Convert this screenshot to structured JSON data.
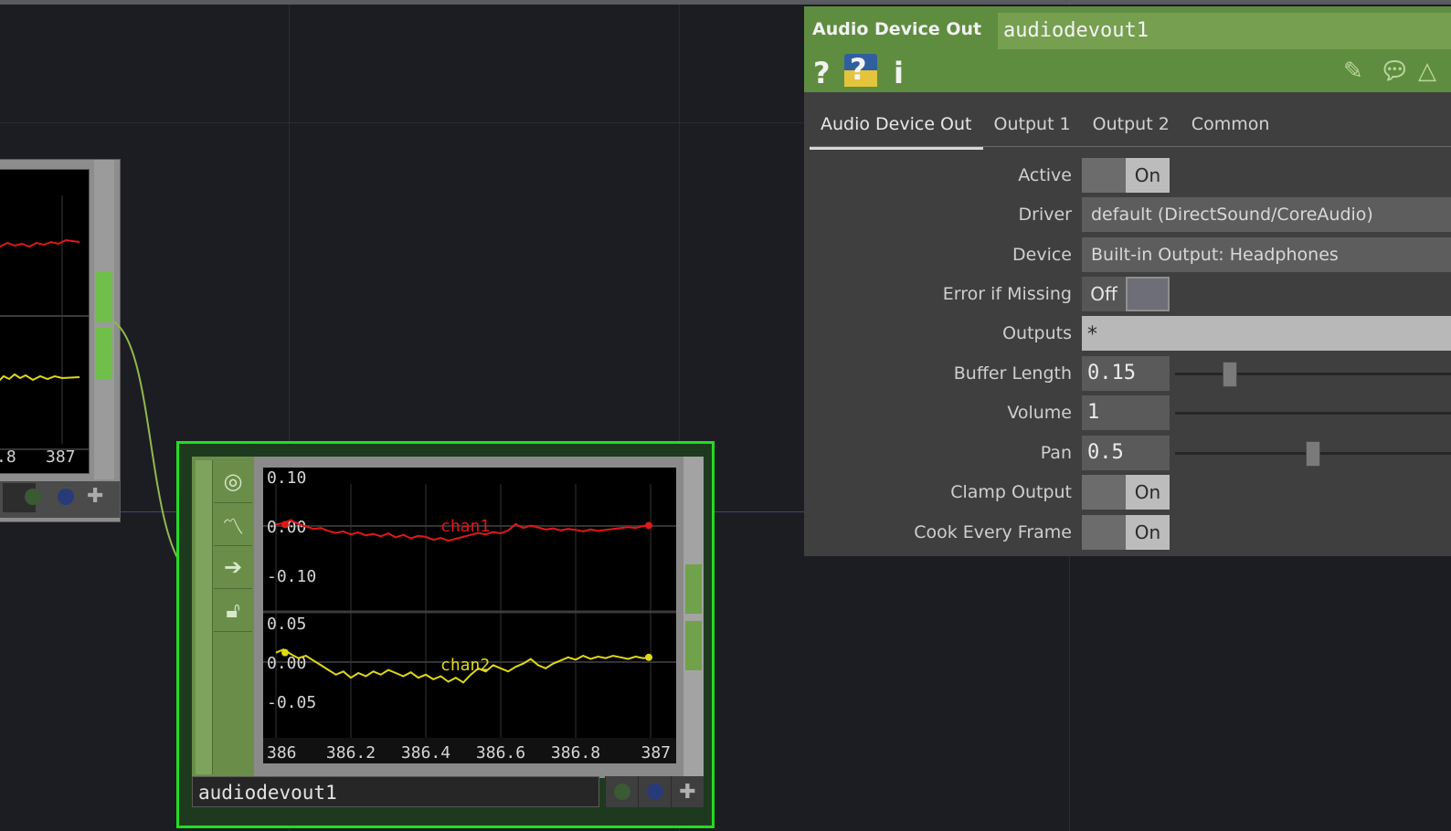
{
  "panel": {
    "op_type": "Audio Device Out",
    "op_name": "audiodevout1",
    "header_icons": [
      "help-icon",
      "python-help-icon",
      "info-icon",
      "pencil-icon",
      "comment-icon",
      "warning-icon"
    ],
    "tabs": [
      {
        "label": "Audio Device Out",
        "active": true
      },
      {
        "label": "Output 1",
        "active": false
      },
      {
        "label": "Output 2",
        "active": false
      },
      {
        "label": "Common",
        "active": false
      }
    ],
    "params": {
      "active": {
        "label": "Active",
        "value": "On"
      },
      "driver": {
        "label": "Driver",
        "value": "default (DirectSound/CoreAudio)"
      },
      "device": {
        "label": "Device",
        "value": "Built-in Output: Headphones"
      },
      "error_if_missing": {
        "label": "Error if Missing",
        "value": "Off"
      },
      "outputs": {
        "label": "Outputs",
        "value": "*"
      },
      "buffer_length": {
        "label": "Buffer Length",
        "value": "0.15",
        "slider_fraction": 0.2
      },
      "volume": {
        "label": "Volume",
        "value": "1",
        "slider_fraction": 0
      },
      "pan": {
        "label": "Pan",
        "value": "0.5",
        "slider_fraction": 0.5
      },
      "clamp_output": {
        "label": "Clamp Output",
        "value": "On"
      },
      "cook_every_frame": {
        "label": "Cook Every Frame",
        "value": "On"
      }
    }
  },
  "node_main": {
    "name": "audiodevout1",
    "flag_colors": [
      "#3a5a34",
      "#283a78"
    ]
  },
  "node_left": {
    "tick_labels": [
      ".8",
      "387"
    ]
  },
  "colors": {
    "chan1": "#e01818",
    "chan2": "#e0d818",
    "node_border": "#22dd22",
    "header_green": "#5f8d3f"
  },
  "chart_data": {
    "type": "line",
    "x_ticks": [
      "386",
      "386.2",
      "386.4",
      "386.6",
      "386.8",
      "387"
    ],
    "xlim": [
      386,
      387
    ],
    "series": [
      {
        "name": "chan1",
        "ylim": [
          -0.1,
          0.1
        ],
        "y_ticks": [
          "0.10",
          "0.00",
          "-0.10"
        ],
        "x": [
          386,
          386.02,
          386.04,
          386.06,
          386.08,
          386.1,
          386.12,
          386.14,
          386.16,
          386.18,
          386.2,
          386.22,
          386.24,
          386.26,
          386.28,
          386.3,
          386.32,
          386.34,
          386.36,
          386.38,
          386.4,
          386.42,
          386.44,
          386.46,
          386.48,
          386.5,
          386.52,
          386.54,
          386.56,
          386.58,
          386.6,
          386.62,
          386.64,
          386.66,
          386.68,
          386.7,
          386.72,
          386.74,
          386.76,
          386.78,
          386.8,
          386.82,
          386.84,
          386.86,
          386.88,
          386.9,
          386.92,
          386.94,
          386.96,
          386.98,
          387
        ],
        "y": [
          0.003,
          0.006,
          0.012,
          0.004,
          -0.001,
          -0.006,
          -0.004,
          -0.01,
          -0.014,
          -0.011,
          -0.017,
          -0.013,
          -0.019,
          -0.016,
          -0.021,
          -0.015,
          -0.023,
          -0.018,
          -0.025,
          -0.02,
          -0.022,
          -0.028,
          -0.024,
          -0.03,
          -0.026,
          -0.022,
          -0.018,
          -0.014,
          -0.017,
          -0.012,
          -0.015,
          -0.009,
          0.004,
          -0.004,
          0.001,
          -0.003,
          -0.007,
          -0.005,
          -0.009,
          -0.006,
          -0.008,
          -0.011,
          -0.007,
          -0.01,
          -0.008,
          -0.006,
          -0.004,
          -0.002,
          -0.004,
          0.0,
          0.001
        ]
      },
      {
        "name": "chan2",
        "ylim": [
          -0.05,
          0.05
        ],
        "y_ticks": [
          "0.05",
          "0.00",
          "-0.05"
        ],
        "x": [
          386,
          386.02,
          386.04,
          386.06,
          386.08,
          386.1,
          386.12,
          386.14,
          386.16,
          386.18,
          386.2,
          386.22,
          386.24,
          386.26,
          386.28,
          386.3,
          386.32,
          386.34,
          386.36,
          386.38,
          386.4,
          386.42,
          386.44,
          386.46,
          386.48,
          386.5,
          386.52,
          386.54,
          386.56,
          386.58,
          386.6,
          386.62,
          386.64,
          386.66,
          386.68,
          386.7,
          386.72,
          386.74,
          386.76,
          386.78,
          386.8,
          386.82,
          386.84,
          386.86,
          386.88,
          386.9,
          386.92,
          386.94,
          386.96,
          386.98,
          387
        ],
        "y": [
          0.012,
          0.016,
          0.01,
          0.005,
          0.008,
          0.002,
          -0.004,
          -0.01,
          -0.016,
          -0.012,
          -0.02,
          -0.014,
          -0.018,
          -0.012,
          -0.016,
          -0.01,
          -0.014,
          -0.018,
          -0.013,
          -0.02,
          -0.016,
          -0.022,
          -0.018,
          -0.025,
          -0.02,
          -0.026,
          -0.016,
          -0.008,
          -0.012,
          -0.004,
          -0.008,
          -0.012,
          -0.006,
          -0.002,
          0.004,
          -0.004,
          -0.008,
          -0.002,
          0.002,
          0.006,
          0.003,
          0.008,
          0.004,
          0.007,
          0.005,
          0.008,
          0.006,
          0.004,
          0.007,
          0.005,
          0.006
        ]
      }
    ]
  }
}
